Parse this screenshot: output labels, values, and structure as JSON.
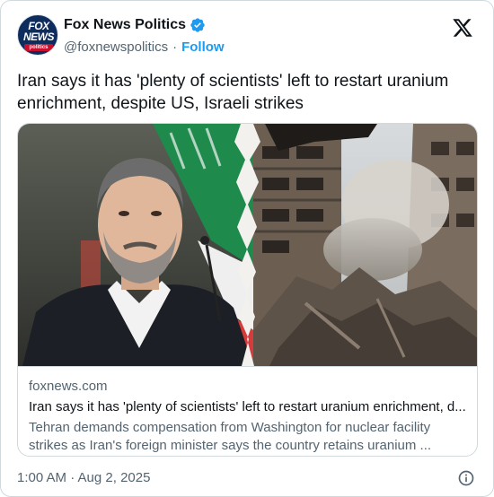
{
  "account": {
    "name": "Fox News Politics",
    "handle": "@foxnewspolitics",
    "separator": "·",
    "follow_label": "Follow",
    "avatar_text_top": "FOX",
    "avatar_text_mid": "NEWS",
    "avatar_text_bar": "politics",
    "verified_color": "#1d9bf0"
  },
  "tweet": {
    "text": "Iran says it has 'plenty of scientists' left to restart uranium enrichment, despite US, Israeli strikes"
  },
  "link_card": {
    "domain": "foxnews.com",
    "title": "Iran says it has 'plenty of scientists' left to restart uranium enrichment, d...",
    "description": "Tehran demands compensation from Washington for nuclear facility strikes as Iran's foreign minister says the country retains uranium ..."
  },
  "footer": {
    "timestamp": "1:00 AM · Aug 2, 2025"
  },
  "colors": {
    "accent": "#1d9bf0",
    "text_primary": "#0f1419",
    "text_secondary": "#536471",
    "border": "#cfd9de"
  },
  "icons": {
    "x_logo": "x-logo-icon",
    "info": "info-icon",
    "verified": "verified-badge-icon"
  }
}
